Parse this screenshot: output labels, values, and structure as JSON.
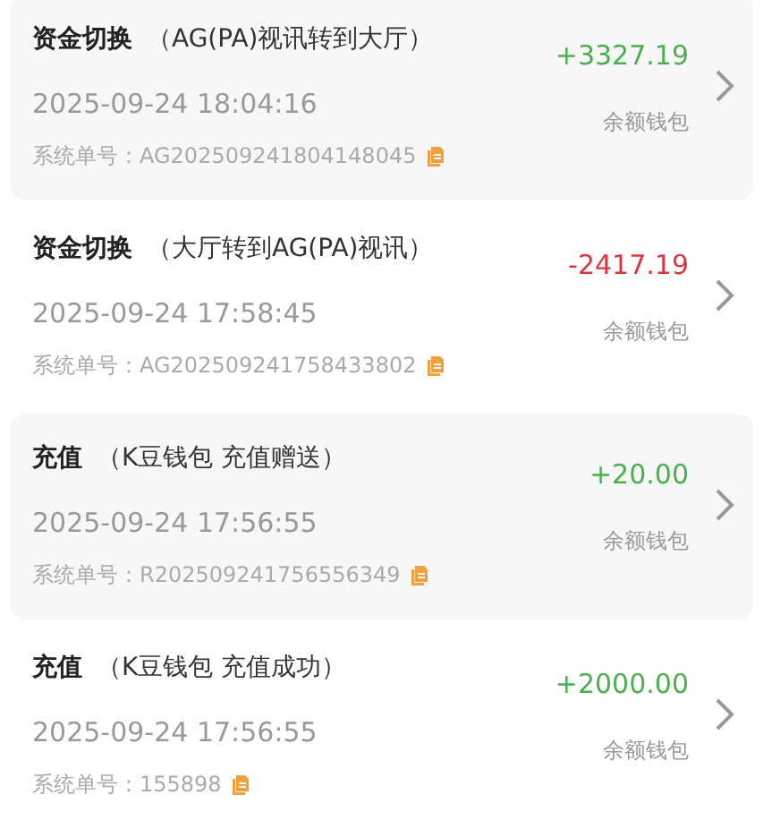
{
  "records": [
    {
      "title": "资金切换",
      "detail": "（AG(PA)视讯转到大厅）",
      "time": "2025-09-24 18:04:16",
      "order_label": "系统单号：",
      "order_no": "AG202509241804148045",
      "amount": "+3327.19",
      "kind": "credit",
      "wallet": "余额钱包"
    },
    {
      "title": "资金切换",
      "detail": "（大厅转到AG(PA)视讯）",
      "time": "2025-09-24 17:58:45",
      "order_label": "系统单号：",
      "order_no": "AG202509241758433802",
      "amount": "-2417.19",
      "kind": "debit",
      "wallet": "余额钱包"
    },
    {
      "title": "充值",
      "detail": "（K豆钱包 充值赠送）",
      "time": "2025-09-24 17:56:55",
      "order_label": "系统单号：",
      "order_no": "R202509241756556349",
      "amount": "+20.00",
      "kind": "credit",
      "wallet": "余额钱包"
    },
    {
      "title": "充值",
      "detail": "（K豆钱包 充值成功）",
      "time": "2025-09-24 17:56:55",
      "order_label": "系统单号：",
      "order_no": "155898",
      "amount": "+2000.00",
      "kind": "credit",
      "wallet": "余额钱包"
    }
  ]
}
